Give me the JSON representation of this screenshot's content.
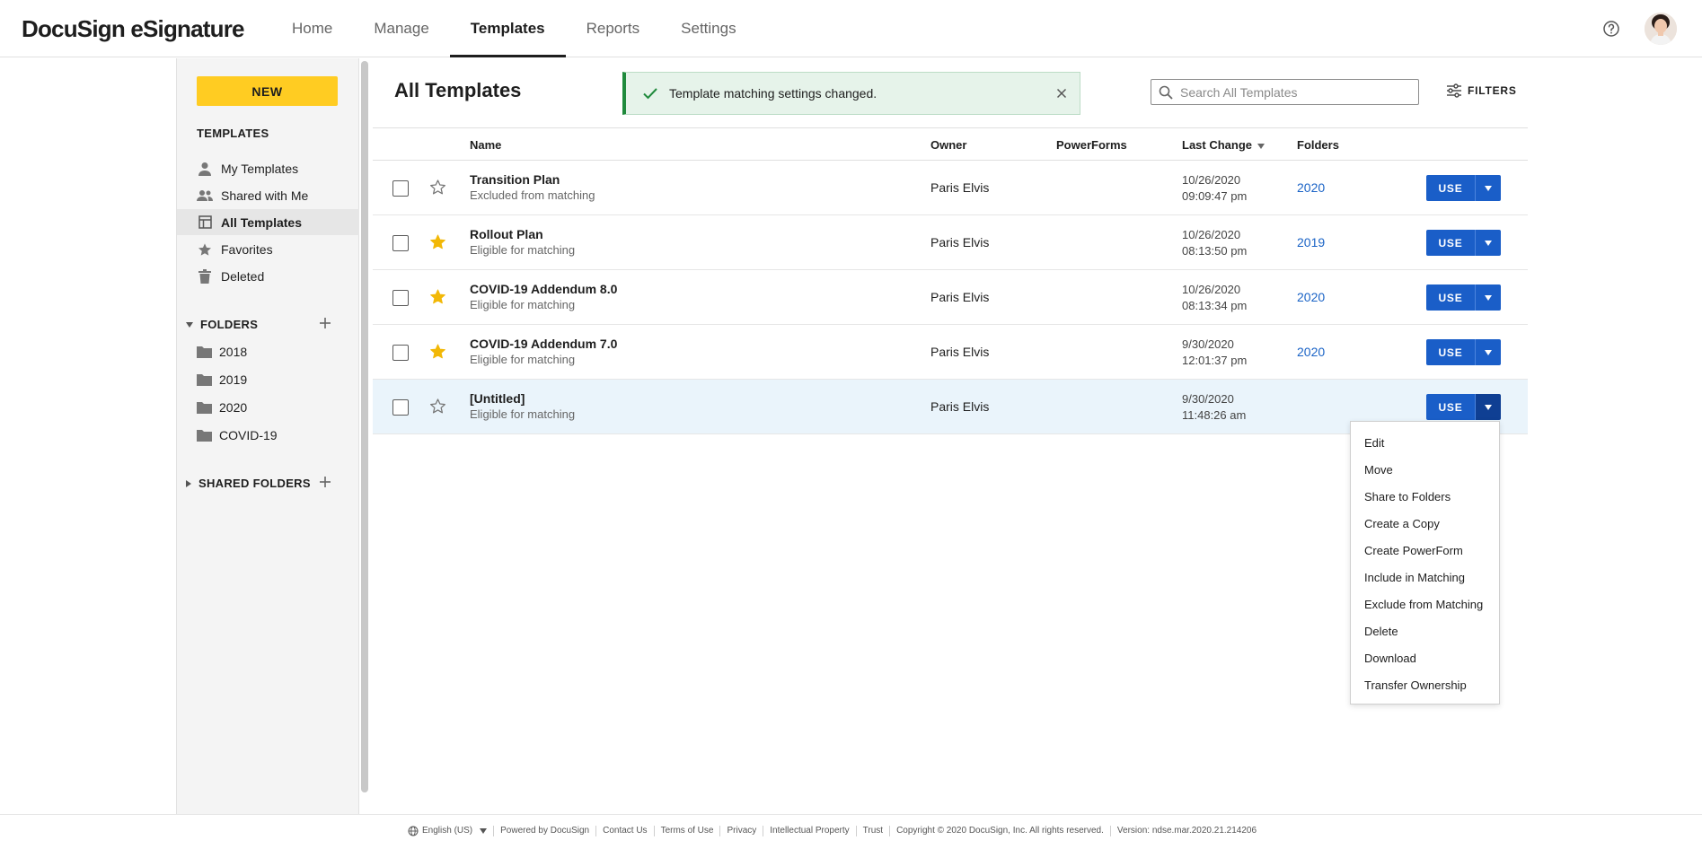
{
  "app": {
    "logo": "DocuSign eSignature",
    "nav": [
      {
        "label": "Home",
        "active": false
      },
      {
        "label": "Manage",
        "active": false
      },
      {
        "label": "Templates",
        "active": true
      },
      {
        "label": "Reports",
        "active": false
      },
      {
        "label": "Settings",
        "active": false
      }
    ],
    "icons": {
      "help": "help-circle-icon",
      "avatar": "user-avatar"
    }
  },
  "sidebar": {
    "new_label": "NEW",
    "templates_heading": "TEMPLATES",
    "items": [
      {
        "label": "My Templates",
        "icon": "person-icon",
        "active": false
      },
      {
        "label": "Shared with Me",
        "icon": "people-icon",
        "active": false
      },
      {
        "label": "All Templates",
        "icon": "template-grid-icon",
        "active": true
      },
      {
        "label": "Favorites",
        "icon": "star-icon",
        "active": false
      },
      {
        "label": "Deleted",
        "icon": "trash-icon",
        "active": false
      }
    ],
    "folders_heading": "FOLDERS",
    "folders": [
      "2018",
      "2019",
      "2020",
      "COVID-19"
    ],
    "shared_folders_heading": "SHARED FOLDERS"
  },
  "main": {
    "title": "All Templates",
    "toast": {
      "message": "Template matching settings changed."
    },
    "search": {
      "placeholder": "Search All Templates",
      "value": ""
    },
    "filters_label": "FILTERS"
  },
  "table": {
    "columns": {
      "name": "Name",
      "owner": "Owner",
      "powerforms": "PowerForms",
      "last_change": "Last Change",
      "folders": "Folders"
    },
    "rows": [
      {
        "name": "Transition Plan",
        "status": "Excluded from matching",
        "owner": "Paris Elvis",
        "date": "10/26/2020",
        "time": "09:09:47 pm",
        "folder": "2020",
        "favorite": false,
        "selected": false
      },
      {
        "name": "Rollout Plan",
        "status": "Eligible for matching",
        "owner": "Paris Elvis",
        "date": "10/26/2020",
        "time": "08:13:50 pm",
        "folder": "2019",
        "favorite": true,
        "selected": false
      },
      {
        "name": "COVID-19 Addendum 8.0",
        "status": "Eligible for matching",
        "owner": "Paris Elvis",
        "date": "10/26/2020",
        "time": "08:13:34 pm",
        "folder": "2020",
        "favorite": true,
        "selected": false
      },
      {
        "name": "COVID-19 Addendum 7.0",
        "status": "Eligible for matching",
        "owner": "Paris Elvis",
        "date": "9/30/2020",
        "time": "12:01:37 pm",
        "folder": "2020",
        "favorite": true,
        "selected": false
      },
      {
        "name": "[Untitled]",
        "status": "Eligible for matching",
        "owner": "Paris Elvis",
        "date": "9/30/2020",
        "time": "11:48:26 am",
        "folder": "",
        "favorite": false,
        "selected": true
      }
    ],
    "use_label": "USE"
  },
  "dropdown_menu": {
    "items": [
      "Edit",
      "Move",
      "Share to Folders",
      "Create a Copy",
      "Create PowerForm",
      "Include in Matching",
      "Exclude from Matching",
      "Delete",
      "Download",
      "Transfer Ownership"
    ]
  },
  "footer": {
    "language": "English (US)",
    "items": [
      "Powered by DocuSign",
      "Contact Us",
      "Terms of Use",
      "Privacy",
      "Intellectual Property",
      "Trust",
      "Copyright © 2020 DocuSign, Inc. All rights reserved.",
      "Version: ndse.mar.2020.21.214206"
    ]
  },
  "colors": {
    "accent_yellow": "#ffcc22",
    "primary_blue": "#1a5ec8",
    "link_blue": "#1a63c6",
    "star_gold": "#f2b807",
    "success_green": "#1f8a3c",
    "toast_bg": "#e6f3ea",
    "selected_row": "#eaf4fb"
  }
}
